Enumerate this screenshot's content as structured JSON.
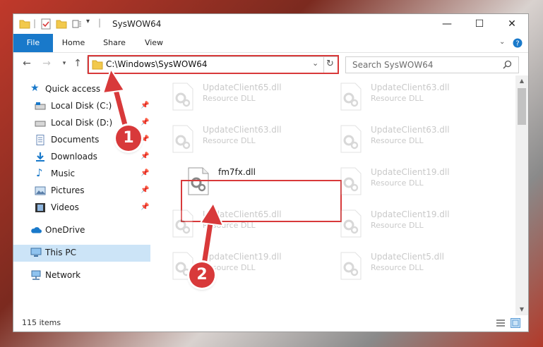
{
  "window": {
    "title": "SysWOW64"
  },
  "ribbon": {
    "tabs": [
      "File",
      "Home",
      "Share",
      "View"
    ]
  },
  "address": {
    "path": "C:\\Windows\\SysWOW64"
  },
  "search": {
    "placeholder": "Search SysWOW64"
  },
  "nav": {
    "items": [
      {
        "label": "Quick access",
        "icon": "star-icon"
      },
      {
        "label": "Local Disk (C:)",
        "icon": "drive-icon",
        "pinned": true
      },
      {
        "label": "Local Disk (D:)",
        "icon": "drive-icon",
        "pinned": true
      },
      {
        "label": "Documents",
        "icon": "document-icon",
        "pinned": true
      },
      {
        "label": "Downloads",
        "icon": "download-icon",
        "pinned": true
      },
      {
        "label": "Music",
        "icon": "music-icon",
        "pinned": true
      },
      {
        "label": "Pictures",
        "icon": "picture-icon",
        "pinned": true
      },
      {
        "label": "Videos",
        "icon": "video-icon",
        "pinned": true
      },
      {
        "label": "OneDrive",
        "icon": "cloud-icon"
      },
      {
        "label": "This PC",
        "icon": "computer-icon",
        "selected": true
      },
      {
        "label": "Network",
        "icon": "network-icon"
      }
    ]
  },
  "files": [
    {
      "name": "UpdateClient65.dll",
      "type": "Resource DLL"
    },
    {
      "name": "UpdateClient63.dll",
      "type": "Resource DLL"
    },
    {
      "name": "UpdateClient63.dll",
      "type": "Resource DLL"
    },
    {
      "name": "UpdateClient63.dll",
      "type": "Resource DLL"
    },
    {
      "name": "fm7fx.dll",
      "type": ""
    },
    {
      "name": "UpdateClient19.dll",
      "type": "Resource DLL"
    },
    {
      "name": "UpdateClient65.dll",
      "type": "Resource DLL"
    },
    {
      "name": "UpdateClient19.dll",
      "type": "Resource DLL"
    },
    {
      "name": "UpdateClient19.dll",
      "type": "Resource DLL"
    },
    {
      "name": "UpdateClient5.dll",
      "type": "Resource DLL"
    }
  ],
  "status": {
    "count": "115 items"
  },
  "annotations": {
    "step1": "1",
    "step2": "2",
    "color": "#d8393a"
  }
}
